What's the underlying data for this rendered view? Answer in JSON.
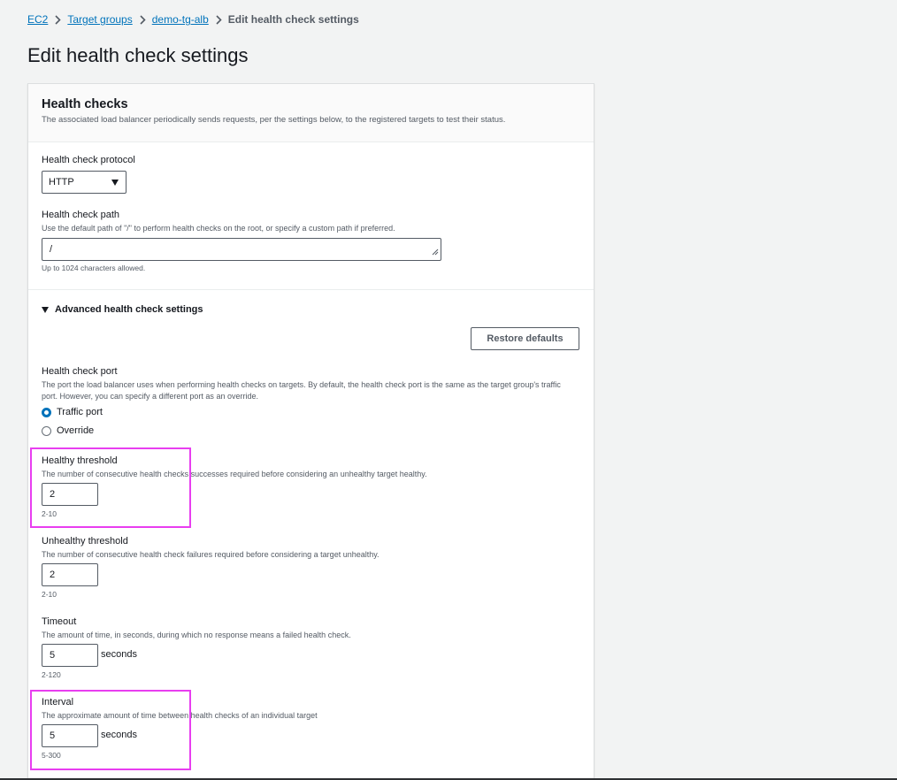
{
  "breadcrumb": {
    "items": [
      "EC2",
      "Target groups",
      "demo-tg-alb"
    ],
    "current": "Edit health check settings"
  },
  "page": {
    "title": "Edit health check settings"
  },
  "health_checks": {
    "title": "Health checks",
    "description": "The associated load balancer periodically sends requests, per the settings below, to the registered targets to test their status.",
    "protocol": {
      "label": "Health check protocol",
      "value": "HTTP"
    },
    "path": {
      "label": "Health check path",
      "description": "Use the default path of \"/\" to perform health checks on the root, or specify a custom path if preferred.",
      "value": "/",
      "constraint": "Up to 1024 characters allowed."
    }
  },
  "advanced": {
    "toggle_label": "Advanced health check settings",
    "restore_button": "Restore defaults",
    "port": {
      "label": "Health check port",
      "description": "The port the load balancer uses when performing health checks on targets. By default, the health check port is the same as the target group's traffic port. However, you can specify a different port as an override.",
      "options": [
        "Traffic port",
        "Override"
      ],
      "selected": "Traffic port"
    },
    "healthy_threshold": {
      "label": "Healthy threshold",
      "description": "The number of consecutive health checks successes required before considering an unhealthy target healthy.",
      "value": "2",
      "constraint": "2-10"
    },
    "unhealthy_threshold": {
      "label": "Unhealthy threshold",
      "description": "The number of consecutive health check failures required before considering a target unhealthy.",
      "value": "2",
      "constraint": "2-10"
    },
    "timeout": {
      "label": "Timeout",
      "description": "The amount of time, in seconds, during which no response means a failed health check.",
      "value": "5",
      "unit": "seconds",
      "constraint": "2-120"
    },
    "interval": {
      "label": "Interval",
      "description": "The approximate amount of time between health checks of an individual target",
      "value": "5",
      "unit": "seconds",
      "constraint": "5-300"
    }
  },
  "colors": {
    "link": "#0073bb",
    "highlight": "#e83ef0",
    "background": "#f2f3f3"
  }
}
